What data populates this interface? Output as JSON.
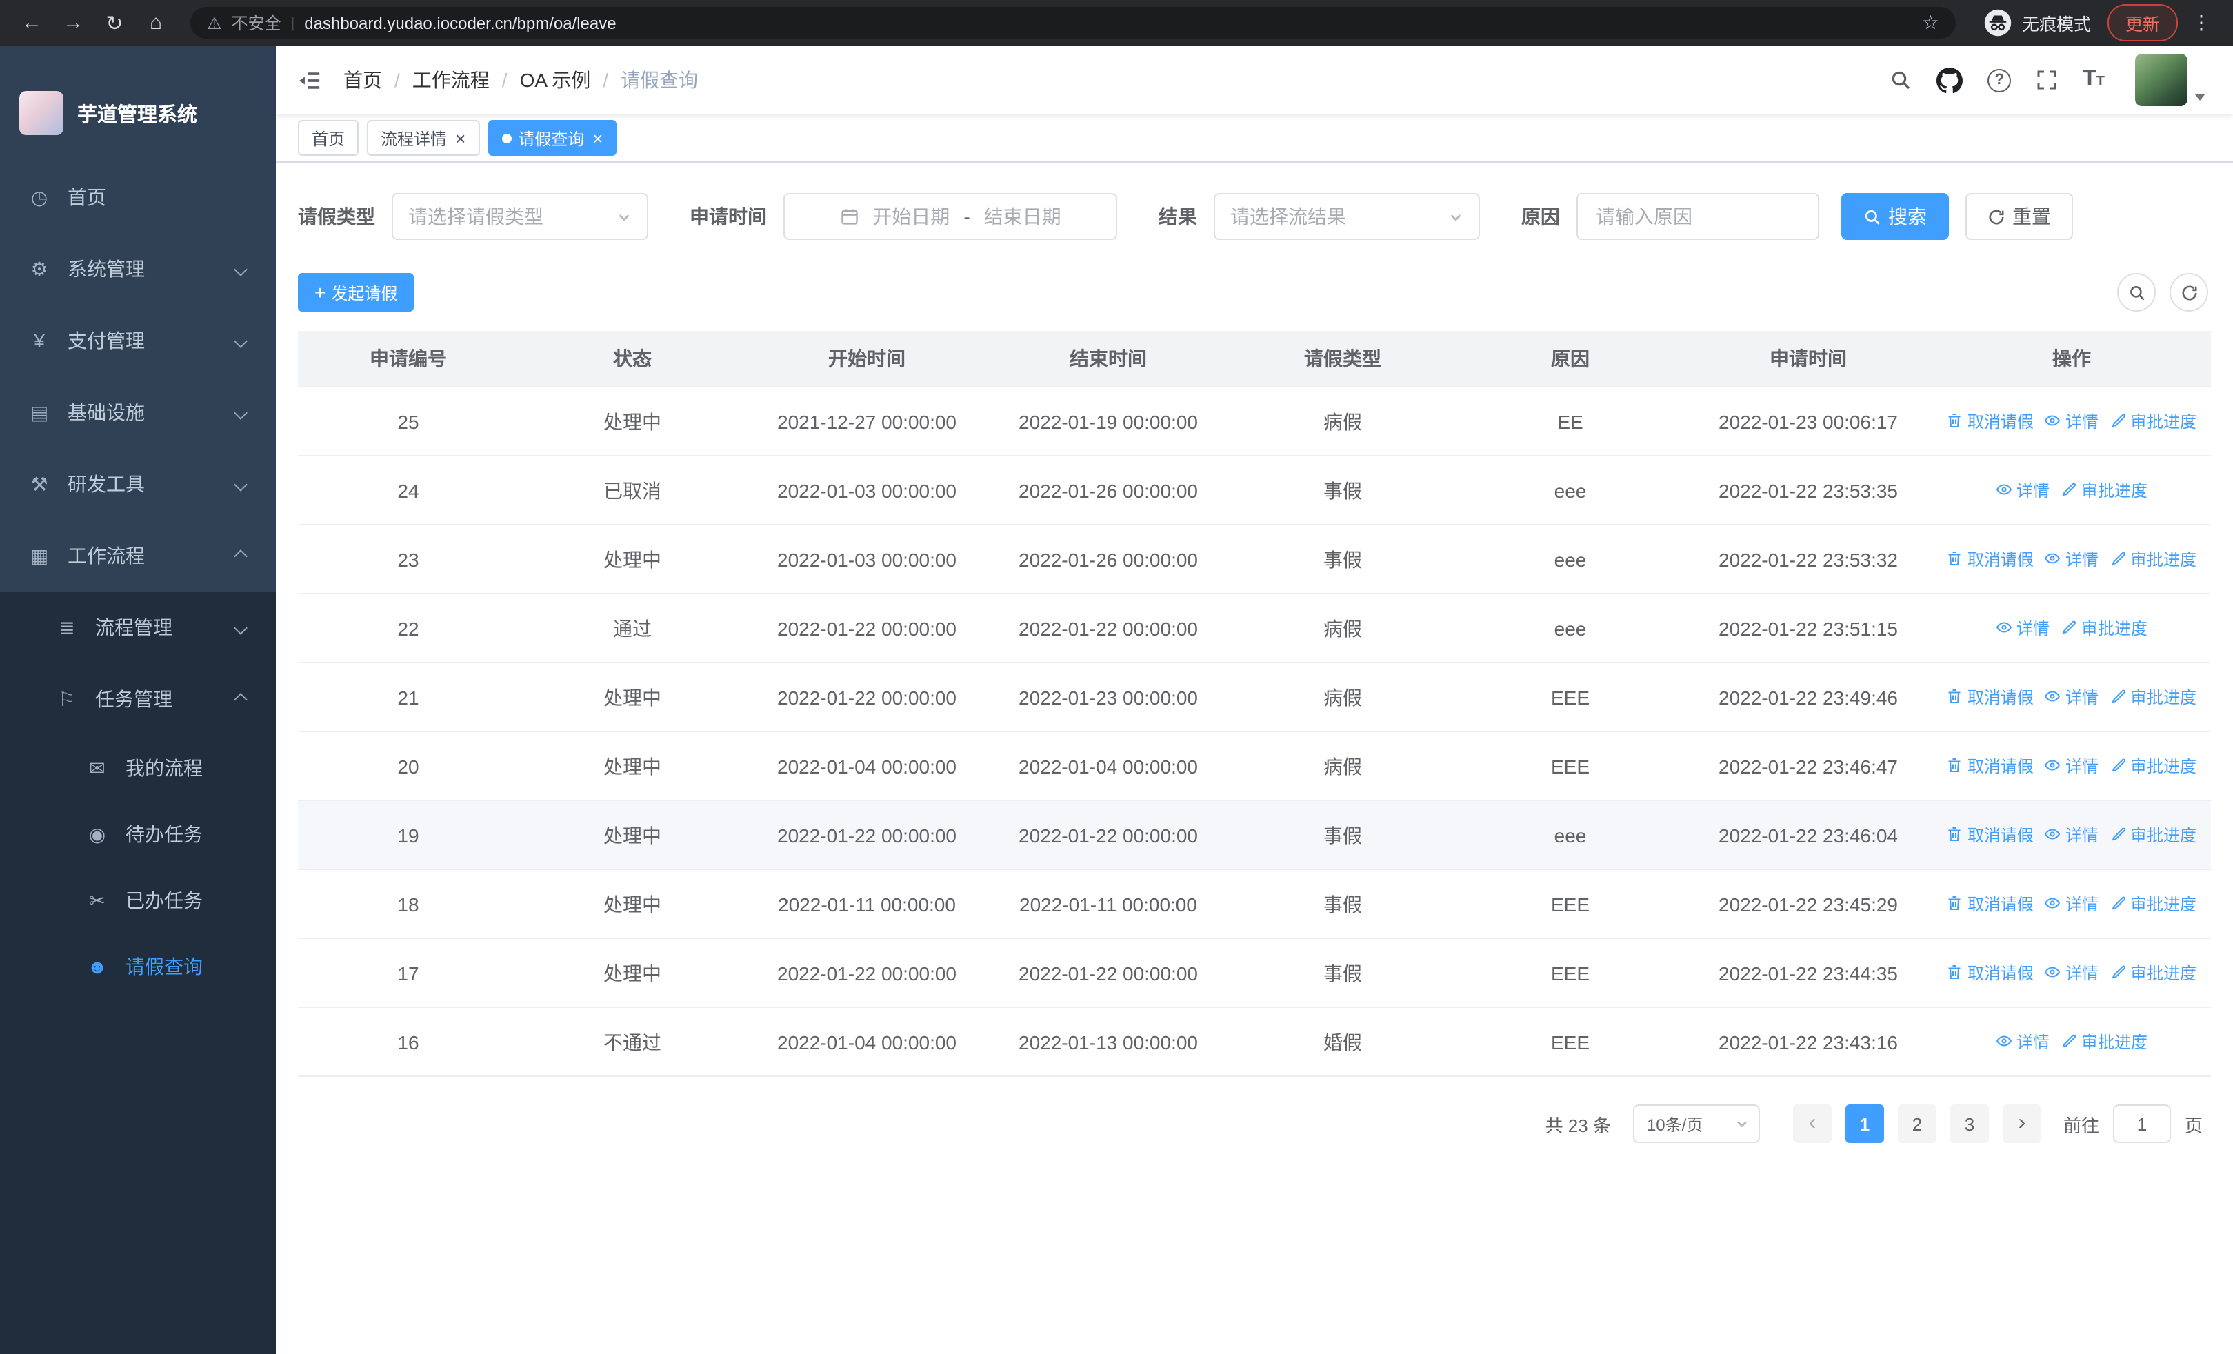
{
  "browser": {
    "security_label": "不安全",
    "url": "dashboard.yudao.iocoder.cn/bpm/oa/leave",
    "incognito_label": "无痕模式",
    "update_label": "更新"
  },
  "sidebar": {
    "app_title": "芋道管理系统",
    "items": [
      {
        "key": "home",
        "label": "首页",
        "icon": "dashboard",
        "level": 1
      },
      {
        "key": "system-mgmt",
        "label": "系统管理",
        "icon": "gear",
        "level": 1,
        "chevron": "down"
      },
      {
        "key": "payment-mgmt",
        "label": "支付管理",
        "icon": "yen",
        "level": 1,
        "chevron": "down"
      },
      {
        "key": "infrastructure",
        "label": "基础设施",
        "icon": "infra",
        "level": 1,
        "chevron": "down"
      },
      {
        "key": "dev-tools",
        "label": "研发工具",
        "icon": "tools",
        "level": 1,
        "chevron": "down"
      },
      {
        "key": "workflow",
        "label": "工作流程",
        "icon": "workflow",
        "level": 1,
        "chevron": "up"
      },
      {
        "key": "process-mgmt",
        "label": "流程管理",
        "icon": "list",
        "level": 2,
        "chevron": "down"
      },
      {
        "key": "task-mgmt",
        "label": "任务管理",
        "icon": "task",
        "level": 2,
        "chevron": "up"
      },
      {
        "key": "my-process",
        "label": "我的流程",
        "icon": "chat",
        "level": 3
      },
      {
        "key": "todo-tasks",
        "label": "待办任务",
        "icon": "eye",
        "level": 3
      },
      {
        "key": "done-tasks",
        "label": "已办任务",
        "icon": "done",
        "level": 3
      },
      {
        "key": "leave-query",
        "label": "请假查询",
        "icon": "user",
        "level": 3,
        "active": true
      }
    ]
  },
  "header": {
    "breadcrumb": [
      "首页",
      "工作流程",
      "OA 示例",
      "请假查询"
    ]
  },
  "tabs": [
    {
      "key": "home",
      "label": "首页",
      "closable": false,
      "active": false
    },
    {
      "key": "process-detail",
      "label": "流程详情",
      "closable": true,
      "active": false
    },
    {
      "key": "leave-query",
      "label": "请假查询",
      "closable": true,
      "active": true
    }
  ],
  "filters": {
    "leave_type_label": "请假类型",
    "leave_type_placeholder": "请选择请假类型",
    "apply_time_label": "申请时间",
    "start_placeholder": "开始日期",
    "range_separator": "-",
    "end_placeholder": "结束日期",
    "result_label": "结果",
    "result_placeholder": "请选择流结果",
    "reason_label": "原因",
    "reason_placeholder": "请输入原因",
    "search_label": "搜索",
    "reset_label": "重置"
  },
  "toolbar": {
    "create_label": "发起请假"
  },
  "table": {
    "columns": [
      "申请编号",
      "状态",
      "开始时间",
      "结束时间",
      "请假类型",
      "原因",
      "申请时间",
      "操作"
    ],
    "column_keys": [
      "id",
      "status",
      "start-time",
      "end-time",
      "leave-type",
      "reason",
      "apply-time"
    ],
    "actions": {
      "cancel": "取消请假",
      "detail": "详情",
      "progress": "审批进度"
    },
    "rows": [
      {
        "id": "25",
        "status": "处理中",
        "start": "2021-12-27 00:00:00",
        "end": "2022-01-19 00:00:00",
        "type": "病假",
        "reason": "EE",
        "apply_time": "2022-01-23 00:06:17",
        "cancelable": true
      },
      {
        "id": "24",
        "status": "已取消",
        "start": "2022-01-03 00:00:00",
        "end": "2022-01-26 00:00:00",
        "type": "事假",
        "reason": "eee",
        "apply_time": "2022-01-22 23:53:35",
        "cancelable": false
      },
      {
        "id": "23",
        "status": "处理中",
        "start": "2022-01-03 00:00:00",
        "end": "2022-01-26 00:00:00",
        "type": "事假",
        "reason": "eee",
        "apply_time": "2022-01-22 23:53:32",
        "cancelable": true
      },
      {
        "id": "22",
        "status": "通过",
        "start": "2022-01-22 00:00:00",
        "end": "2022-01-22 00:00:00",
        "type": "病假",
        "reason": "eee",
        "apply_time": "2022-01-22 23:51:15",
        "cancelable": false
      },
      {
        "id": "21",
        "status": "处理中",
        "start": "2022-01-22 00:00:00",
        "end": "2022-01-23 00:00:00",
        "type": "病假",
        "reason": "EEE",
        "apply_time": "2022-01-22 23:49:46",
        "cancelable": true
      },
      {
        "id": "20",
        "status": "处理中",
        "start": "2022-01-04 00:00:00",
        "end": "2022-01-04 00:00:00",
        "type": "病假",
        "reason": "EEE",
        "apply_time": "2022-01-22 23:46:47",
        "cancelable": true
      },
      {
        "id": "19",
        "status": "处理中",
        "start": "2022-01-22 00:00:00",
        "end": "2022-01-22 00:00:00",
        "type": "事假",
        "reason": "eee",
        "apply_time": "2022-01-22 23:46:04",
        "cancelable": true,
        "highlighted": true
      },
      {
        "id": "18",
        "status": "处理中",
        "start": "2022-01-11 00:00:00",
        "end": "2022-01-11 00:00:00",
        "type": "事假",
        "reason": "EEE",
        "apply_time": "2022-01-22 23:45:29",
        "cancelable": true
      },
      {
        "id": "17",
        "status": "处理中",
        "start": "2022-01-22 00:00:00",
        "end": "2022-01-22 00:00:00",
        "type": "事假",
        "reason": "EEE",
        "apply_time": "2022-01-22 23:44:35",
        "cancelable": true
      },
      {
        "id": "16",
        "status": "不通过",
        "start": "2022-01-04 00:00:00",
        "end": "2022-01-13 00:00:00",
        "type": "婚假",
        "reason": "EEE",
        "apply_time": "2022-01-22 23:43:16",
        "cancelable": false
      }
    ]
  },
  "pagination": {
    "total_label": "共 23 条",
    "page_size_label": "10条/页",
    "pages": [
      "1",
      "2",
      "3"
    ],
    "active_page": "1",
    "goto_label": "前往",
    "goto_value": "1",
    "page_unit_label": "页"
  },
  "colors": {
    "primary": "#409eff",
    "sidebar_bg": "#304156",
    "submenu_bg": "#1f2d3d"
  }
}
